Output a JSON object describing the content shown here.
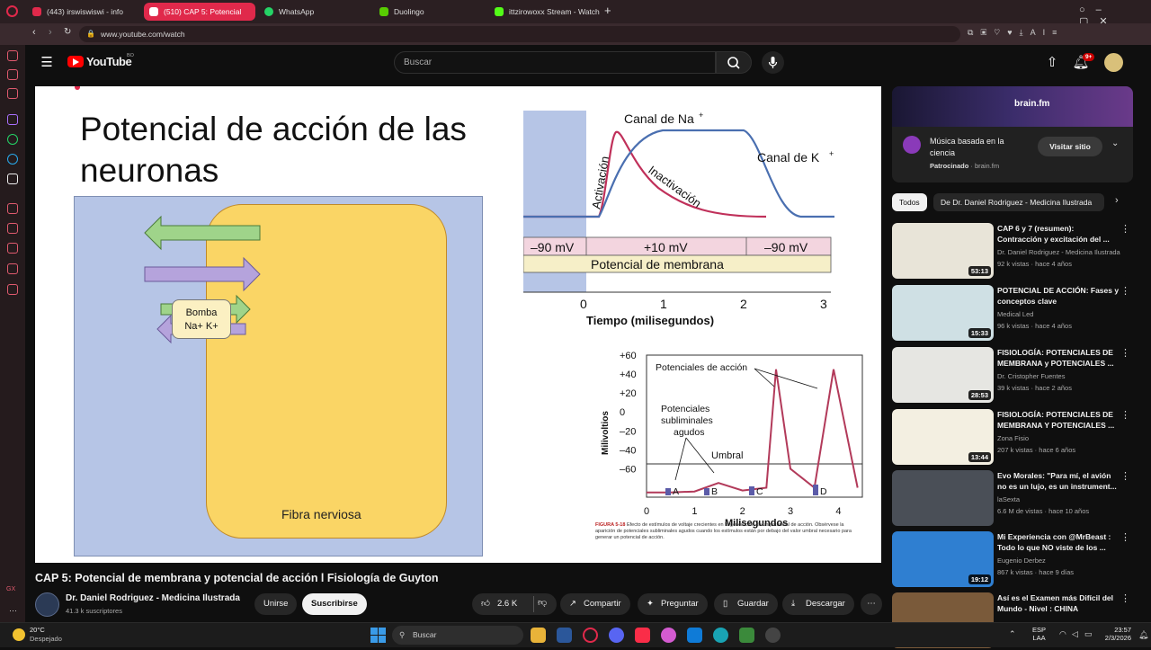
{
  "browser": {
    "tabs": [
      {
        "label": "(443) irswiswiswi - info",
        "color": "#e0294b"
      },
      {
        "label": "(510) CAP 5: Potencial",
        "color": "#ff0000"
      },
      {
        "label": "WhatsApp",
        "color": "#25d366"
      },
      {
        "label": "Duolingo",
        "color": "#58cc02"
      },
      {
        "label": "ittzirowoxx Stream - Watch",
        "color": "#53fc18"
      }
    ],
    "url": "www.youtube.com/watch"
  },
  "youtube": {
    "logo": "YouTube",
    "country_code": "BO",
    "search_placeholder": "Buscar",
    "notif_badge": "9+"
  },
  "slide": {
    "title": "Potencial de acción de las neuronas",
    "bomba_line1": "Bomba",
    "bomba_line2": "Na+ K+",
    "fiber_label": "Fibra nerviosa",
    "chart1": {
      "na_label": "Canal de Na",
      "k_label": "Canal de K",
      "activation": "Activación",
      "inactivation": "Inactivación",
      "row1": [
        "–90 mV",
        "+10 mV",
        "–90 mV"
      ],
      "row2": "Potencial de membrana",
      "xlabel": "Tiempo (milisegundos)",
      "xticks": [
        "0",
        "1",
        "2",
        "3"
      ]
    },
    "chart2": {
      "ylabel": "Milivoltios",
      "xlabel": "Milisegundos",
      "yticks": [
        "+60",
        "+40",
        "+20",
        "0",
        "–20",
        "–40",
        "–60"
      ],
      "xticks": [
        "0",
        "1",
        "2",
        "3",
        "4"
      ],
      "ann_pa": "Potenciales de acción",
      "ann_sub1": "Potenciales",
      "ann_sub2": "subliminales",
      "ann_sub3": "agudos",
      "ann_umbral": "Umbral",
      "stim": [
        "A",
        "B",
        "C",
        "D"
      ]
    },
    "caption_fig": "FIGURA 5-18",
    "caption_text": "Efecto de estímulos de voltaje crecientes en la generación de un potencial de acción. Obsérvese la aparición de potenciales subliminales agudos cuando los estímulos están por debajo del valor umbral necesario para generar un potencial de acción."
  },
  "chart_data": {
    "type": "line",
    "title": "",
    "xlabel": "Milisegundos",
    "ylabel": "Milivoltios",
    "x": [
      0,
      0.5,
      1,
      1.5,
      2,
      2.5,
      2.7,
      3,
      3.5,
      3.9,
      4.4
    ],
    "series": [
      {
        "values": [
          -85,
          -85,
          -84,
          -75,
          -83,
          -80,
          45,
          -60,
          -80,
          45,
          -80
        ]
      }
    ],
    "ylim": [
      -90,
      60
    ],
    "xlim": [
      0,
      4.5
    ]
  },
  "video": {
    "title": "CAP 5: Potencial de membrana y potencial de acción l Fisiología de Guyton",
    "channel": "Dr. Daniel Rodriguez - Medicina Ilustrada",
    "subs": "41.3 k suscriptores",
    "join": "Unirse",
    "subscribe": "Suscribirse",
    "likes": "2.6 K",
    "share": "Compartir",
    "ask": "Preguntar",
    "save": "Guardar",
    "download": "Descargar"
  },
  "ad": {
    "brand": "brain.fm",
    "title": "Música basada en la ciencia",
    "sponsored": "Patrocinado",
    "domain": "brain.fm",
    "cta": "Visitar sitio"
  },
  "chips": [
    "Todos",
    "De Dr. Daniel Rodriguez - Medicina Ilustrada"
  ],
  "recommendations": [
    {
      "title": "CAP 6 y 7 (resumen): Contracción y excitación del ...",
      "channel": "Dr. Daniel Rodriguez - Medicina Ilustrada",
      "meta": "92 k vistas · hace 4 años",
      "duration": "53:13",
      "color": "#e8e4d8"
    },
    {
      "title": "POTENCIAL DE ACCIÓN: Fases y conceptos clave",
      "channel": "Medical Led",
      "meta": "96 k vistas · hace 4 años",
      "duration": "15:33",
      "color": "#cfe0e4"
    },
    {
      "title": "FISIOLOGÍA: POTENCIALES DE MEMBRANA y POTENCIALES ...",
      "channel": "Dr. Cristopher Fuentes",
      "meta": "39 k vistas · hace 2 años",
      "duration": "28:53",
      "color": "#e6e6e2"
    },
    {
      "title": "FISIOLOGÍA: POTENCIALES DE MEMBRANA Y POTENCIALES ...",
      "channel": "Zona Fisio",
      "meta": "207 k vistas · hace 6 años",
      "duration": "13:44",
      "color": "#f3efe1"
    },
    {
      "title": "Evo Morales: \"Para mí, el avión no es un lujo, es un instrument...",
      "channel": "laSexta",
      "meta": "6.6 M de vistas · hace 10 años",
      "duration": "",
      "color": "#4a4f57"
    },
    {
      "title": "Mi Experiencia con @MrBeast : Todo lo que NO viste de los ...",
      "channel": "Eugenio Derbez",
      "meta": "867 k vistas · hace 9 días",
      "duration": "19:12",
      "color": "#2f7fd1"
    },
    {
      "title": "Así es el Examen más Difícil del Mundo - Nivel : CHINA",
      "channel": "",
      "meta": "",
      "duration": "",
      "color": "#7a5a3a"
    }
  ],
  "taskbar": {
    "temp": "20°C",
    "weather": "Despejado",
    "search": "Buscar",
    "lang1": "ESP",
    "lang2": "LAA",
    "time": "23:57",
    "date": "2/3/2026"
  }
}
